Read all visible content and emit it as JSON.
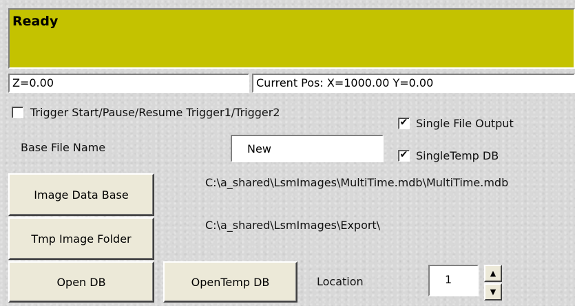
{
  "colors": {
    "status_background": "#c4c200"
  },
  "status": {
    "text": "Ready"
  },
  "readouts": {
    "z": "Z=0.00",
    "current_pos": "Current Pos: X=1000.00 Y=0.00"
  },
  "options": {
    "trigger": {
      "label": "Trigger Start/Pause/Resume Trigger1/Trigger2",
      "checked": false,
      "mark": ""
    },
    "single_file_output": {
      "label": "Single File Output",
      "checked": true,
      "mark": "✔"
    },
    "single_temp_db": {
      "label": "SingleTemp DB",
      "checked": true,
      "mark": "✔"
    }
  },
  "base_file": {
    "label": "Base File Name",
    "value": "New"
  },
  "buttons": {
    "image_data_base": "Image Data Base",
    "tmp_image_folder": "Tmp Image Folder",
    "open_db": "Open DB",
    "open_temp_db": "OpenTemp DB"
  },
  "paths": {
    "image_data_base": "C:\\a_shared\\LsmImages\\MultiTime.mdb\\MultiTime.mdb",
    "tmp_image_folder": "C:\\a_shared\\LsmImages\\Export\\"
  },
  "location": {
    "label": "Location",
    "value": "1",
    "up_icon": "▲",
    "down_icon": "▼"
  }
}
